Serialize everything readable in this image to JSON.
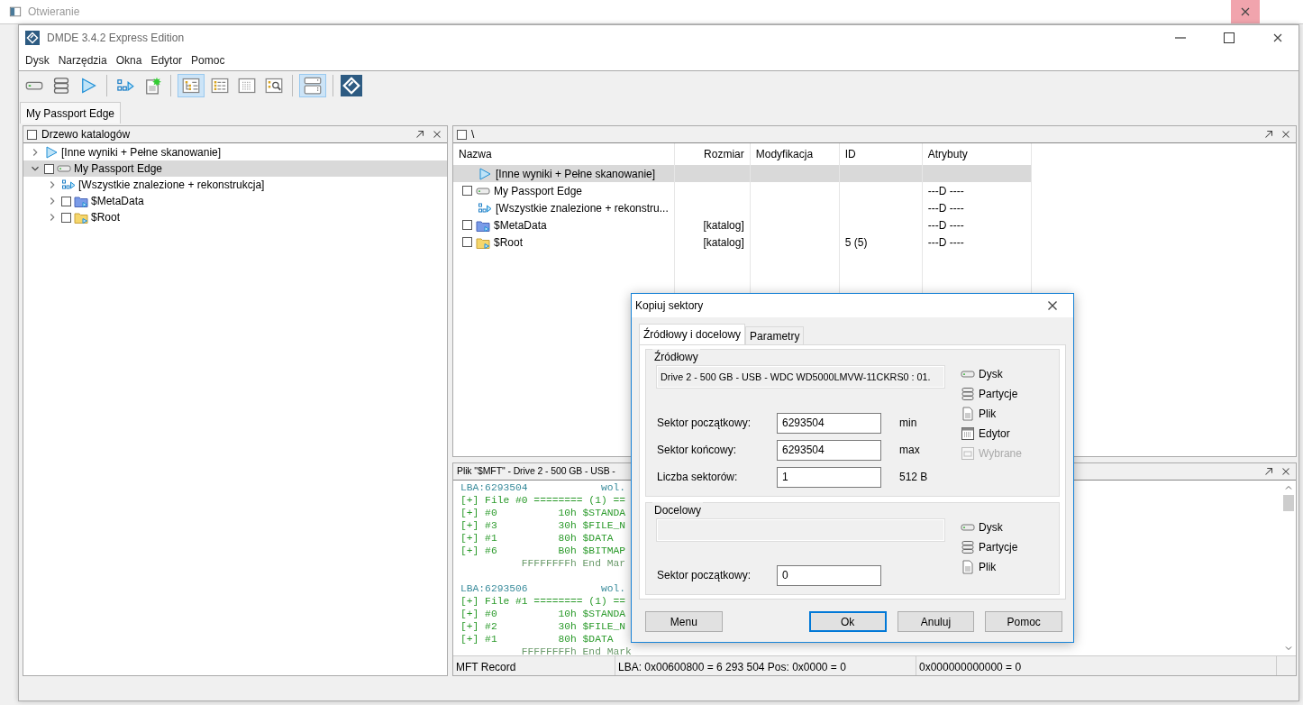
{
  "background_window": {
    "title": "Otwieranie"
  },
  "window": {
    "title": "DMDE 3.4.2 Express Edition"
  },
  "menu": [
    "Dysk",
    "Narzędzia",
    "Okna",
    "Edytor",
    "Pomoc"
  ],
  "toolbar": [
    {
      "kind": "drive",
      "pressed": false
    },
    {
      "kind": "partitions",
      "pressed": false
    },
    {
      "kind": "play",
      "pressed": false
    },
    {
      "kind": "separator"
    },
    {
      "kind": "blocks",
      "pressed": false
    },
    {
      "kind": "new_file",
      "pressed": false
    },
    {
      "kind": "separator"
    },
    {
      "kind": "tree_view",
      "pressed": true
    },
    {
      "kind": "list_view",
      "pressed": false
    },
    {
      "kind": "grid_view",
      "pressed": false
    },
    {
      "kind": "search_view",
      "pressed": false
    },
    {
      "kind": "separator"
    },
    {
      "kind": "panels",
      "pressed": true
    },
    {
      "kind": "separator"
    },
    {
      "kind": "logo",
      "pressed": false
    }
  ],
  "document_tabs": [
    {
      "label": "My Passport Edge",
      "selected": true
    }
  ],
  "tree_panel": {
    "title": "Drzewo katalogów",
    "checked": false,
    "items": [
      {
        "label": "[Inne wyniki + Pełne skanowanie]",
        "kind": "play",
        "expanded": false,
        "selected": false
      },
      {
        "label": "My Passport Edge",
        "kind": "drive",
        "checked": false,
        "expanded": true,
        "selected": true,
        "children": [
          {
            "label": "[Wszystkie znalezione + rekonstrukcja]",
            "kind": "blocks",
            "expanded": false,
            "selected": false
          },
          {
            "label": "$MetaData",
            "kind": "folder_blue",
            "checked": false,
            "expanded": false,
            "selected": false
          },
          {
            "label": "$Root",
            "kind": "folder_yellow",
            "checked": false,
            "expanded": false,
            "selected": false
          }
        ]
      }
    ]
  },
  "list_panel": {
    "title": "\\",
    "checked": false,
    "columns": [
      "Nazwa",
      "Rozmiar",
      "Modyfikacja",
      "ID",
      "Atrybuty"
    ],
    "rows": [
      {
        "name": "[Inne wyniki + Pełne skanowanie]",
        "kind": "play",
        "selected": true
      },
      {
        "name": "My Passport Edge",
        "kind": "drive",
        "checked": false,
        "attributes": "---D ----",
        "selected": false
      },
      {
        "name": "[Wszystkie znalezione + rekonstru...",
        "kind": "blocks",
        "attributes": "---D ----",
        "selected": false
      },
      {
        "name": "$MetaData",
        "kind": "folder_blue",
        "checked": false,
        "size": "[katalog]",
        "attributes": "---D ----",
        "selected": false
      },
      {
        "name": "$Root",
        "kind": "folder_yellow",
        "checked": false,
        "size": "[katalog]",
        "id": "5 (5)",
        "attributes": "---D ----",
        "selected": false
      }
    ]
  },
  "hex_panel": {
    "title": "Plik \"$MFT\" - Drive 2 - 500 GB - USB -",
    "lines": [
      {
        "kind": "lba",
        "text": "LBA:6293504            wol."
      },
      {
        "kind": "entry",
        "text": "[+] File #0 ======== (1) =="
      },
      {
        "kind": "entry",
        "text": "[+] #0          10h $STANDA"
      },
      {
        "kind": "entry",
        "text": "[+] #3          30h $FILE_N"
      },
      {
        "kind": "entry",
        "text": "[+] #1          80h $DATA"
      },
      {
        "kind": "entry",
        "text": "[+] #6          B0h $BITMAP"
      },
      {
        "kind": "end",
        "text": "          FFFFFFFFh End Mar"
      },
      {
        "kind": "blank"
      },
      {
        "kind": "lba",
        "text": "LBA:6293506            wol."
      },
      {
        "kind": "entry",
        "text": "[+] File #1 ======== (1) =="
      },
      {
        "kind": "entry",
        "text": "[+] #0          10h $STANDA"
      },
      {
        "kind": "entry",
        "text": "[+] #2          30h $FILE_N"
      },
      {
        "kind": "entry",
        "text": "[+] #1          80h $DATA"
      },
      {
        "kind": "end",
        "text": "          FFFFFFFFh End Mark"
      }
    ],
    "status_bar": [
      "MFT Record",
      "LBA: 0x00600800 = 6 293 504  Pos: 0x0000 = 0",
      "0x000000000000 = 0"
    ]
  },
  "dialog": {
    "title": "Kopiuj sektory",
    "tabs": [
      {
        "label": "Źródłowy i docelowy",
        "selected": true
      },
      {
        "label": "Parametry",
        "selected": false
      }
    ],
    "groups": [
      {
        "legend": "Źródłowy",
        "device": "Drive 2 - 500 GB - USB - WDC WD5000LMVW-11CKRS0 : 01.",
        "fields": [
          {
            "label": "Sektor początkowy:",
            "value": "6293504",
            "unit": "min"
          },
          {
            "label": "Sektor końcowy:",
            "value": "6293504",
            "unit": "max"
          },
          {
            "label": "Liczba sektorów:",
            "value": "1",
            "unit": "512 B"
          }
        ],
        "options": [
          {
            "label": "Dysk",
            "kind": "drive",
            "disabled": false
          },
          {
            "label": "Partycje",
            "kind": "partitions",
            "disabled": false
          },
          {
            "label": "Plik",
            "kind": "file",
            "disabled": false
          },
          {
            "label": "Edytor",
            "kind": "editor",
            "disabled": false
          },
          {
            "label": "Wybrane",
            "kind": "selection",
            "disabled": true
          }
        ]
      },
      {
        "legend": "Docelowy",
        "fields": [
          {
            "label": "Sektor początkowy:",
            "value": "0"
          }
        ],
        "options": [
          {
            "label": "Dysk",
            "kind": "drive",
            "disabled": false
          },
          {
            "label": "Partycje",
            "kind": "partitions",
            "disabled": false
          },
          {
            "label": "Plik",
            "kind": "file",
            "disabled": false
          }
        ]
      }
    ],
    "buttons": [
      {
        "label": "Menu",
        "default": false
      },
      {
        "label": "Ok",
        "default": true
      },
      {
        "label": "Anuluj",
        "default": false
      },
      {
        "label": "Pomoc",
        "default": false
      }
    ]
  }
}
